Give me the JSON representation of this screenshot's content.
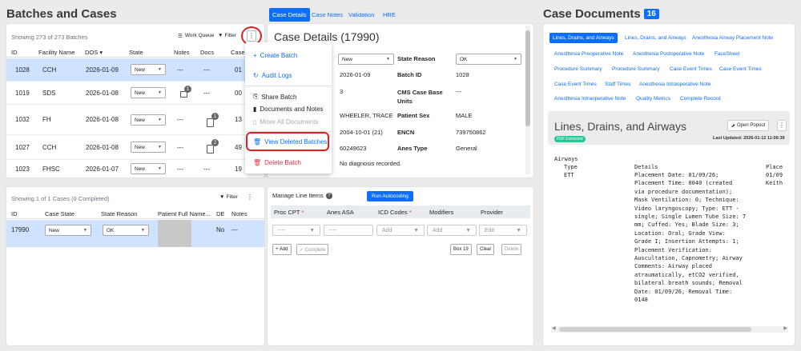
{
  "left": {
    "title": "Batches and Cases",
    "batches": {
      "showing": "Showing 273 of 273 Batches",
      "work_queue": "Work Queue",
      "filter": "Filter",
      "more": "⋮",
      "headers": [
        "ID",
        "Facility Name",
        "DOS",
        "State",
        "Notes",
        "Docs",
        "Case"
      ],
      "rows": [
        {
          "id": "1028",
          "facility": "CCH",
          "dos": "2026-01-09",
          "state": "New",
          "notes": "---",
          "docs": "---",
          "case": "01",
          "note_count": "",
          "doc_count": ""
        },
        {
          "id": "1019",
          "facility": "SDS",
          "dos": "2026-01-08",
          "state": "New",
          "notes": "",
          "docs": "---",
          "case": "00",
          "note_count": "1",
          "doc_count": ""
        },
        {
          "id": "1032",
          "facility": "FH",
          "dos": "2026-01-08",
          "state": "New",
          "notes": "---",
          "docs": "",
          "case": "13",
          "note_count": "",
          "doc_count": "1"
        },
        {
          "id": "1027",
          "facility": "CCH",
          "dos": "2026-01-08",
          "state": "New",
          "notes": "---",
          "docs": "",
          "case": "49",
          "note_count": "",
          "doc_count": "2"
        },
        {
          "id": "1023",
          "facility": "FHSC",
          "dos": "2026-01-07",
          "state": "New",
          "notes": "---",
          "docs": "---",
          "case": "19",
          "note_count": "",
          "doc_count": ""
        }
      ]
    },
    "cases": {
      "showing": "Showing 1 of 1 Cases (0 Completed)",
      "filter": "Filter",
      "more": "⋮",
      "headers": [
        "ID",
        "Case State",
        "State Reason",
        "Patient Full Name...",
        "DE",
        "Notes"
      ],
      "row": {
        "id": "17990",
        "state": "New",
        "reason": "OK",
        "de": "No",
        "notes": "---"
      }
    }
  },
  "menu": {
    "items": [
      {
        "label": "Create Batch",
        "icon": "+"
      },
      {
        "label": "Audit Logs",
        "icon": "↻"
      },
      {
        "label": "Share Batch",
        "icon": "⎘"
      },
      {
        "label": "Documents and Notes",
        "icon": "▮"
      },
      {
        "label": "Move All Documents",
        "icon": "▯"
      },
      {
        "label": "View Deleted Batches",
        "icon": "🗑"
      },
      {
        "label": "Delete Batch",
        "icon": "🗑"
      }
    ]
  },
  "middle": {
    "tabs": [
      "Case Details",
      "Case Notes",
      "Validation",
      "HRE"
    ],
    "title": "Case Details (17990)",
    "fields": {
      "state_value": "New",
      "state_reason_label": "State Reason",
      "state_reason_value": "OK",
      "dos_value": "2026-01-09",
      "batch_id_label": "Batch ID",
      "batch_id_value": "1028",
      "units_value": "3",
      "cms_label": "CMS Case Base Units",
      "cms_value": "---",
      "name_value": "WHEELER, TRACE",
      "sex_label": "Patient Sex",
      "sex_value": "MALE",
      "dob_value": "2004-10-01 (21)",
      "encn_label": "ENCN",
      "encn_value": "739750862",
      "mrn_value": "60249623",
      "anes_label": "Anes Type",
      "anes_value": "General",
      "diag_value": "No diagnosis recorded."
    },
    "line_items": {
      "title": "Manage Line Items",
      "run": "Run Autocoding",
      "headers": [
        "Proc CPT",
        "Anes ASA",
        "ICD Codes",
        "Modifiers",
        "Provider"
      ],
      "proc_placeholder": "----",
      "asa_placeholder": "----",
      "icd_placeholder": "Add",
      "mod_placeholder": "Add",
      "provider_placeholder": "Edit",
      "add": "+ Add",
      "complete": "✓ Complete",
      "box": "Box 19",
      "clear": "Clear",
      "delete": "Delete"
    }
  },
  "right": {
    "title": "Case Documents",
    "count": "16",
    "links": [
      "Lines, Drains, and Airways",
      "Lines, Drains, and Airways",
      "Anesthesia Airway Placement Note",
      "Anesthesia Preoperative Note",
      "Anesthesia Postoperative Note",
      "FaceSheet",
      "Procedure Summary",
      "Procedure Summary",
      "Case Event Times",
      "Case Event Times",
      "Case Event Times",
      "Staff Times",
      "Anesthesia Intraoperative Note",
      "Anesthesia Intraoperative Note",
      "Quality Metrics",
      "Complete Record"
    ],
    "doc_title": "Lines, Drains, and Airways",
    "open_popout": "Open Popout",
    "more": "⋮",
    "pdf_badge": "PDF Extracted",
    "last_updated": "Last Updated: 2026-01-12 11:06:39",
    "doc_section": "Airways",
    "col_type": "Type",
    "col_details": "Details",
    "col_place": "Place",
    "type_value": "ETT",
    "details_text": "Placement Date: 01/09/26;\nPlacement Time: 0040 (created\nvia procedure documentation);\nMask Ventilation: 0; Technique:\nVideo laryngoscopy; Type: ETT -\nsingle; Single Lumen Tube Size: 7\nmm; Cuffed: Yes; Blade Size: 3;\nLocation: Oral; Grade View:\nGrade I; Insertion Attempts: 1;\nPlacement Verification:\nAuscultation, Capnometry; Airway\nComments: Airway placed\natraumatically, etCO2 verified,\nbilateral breath sounds; Removal\nDate: 01/09/26; Removal Time:\n0148",
    "place_value1": "01/09",
    "place_value2": "Keith"
  },
  "colors": {
    "accent": "#0d6efd",
    "selected_row": "#cfe2ff",
    "annotation": "#e02020"
  }
}
